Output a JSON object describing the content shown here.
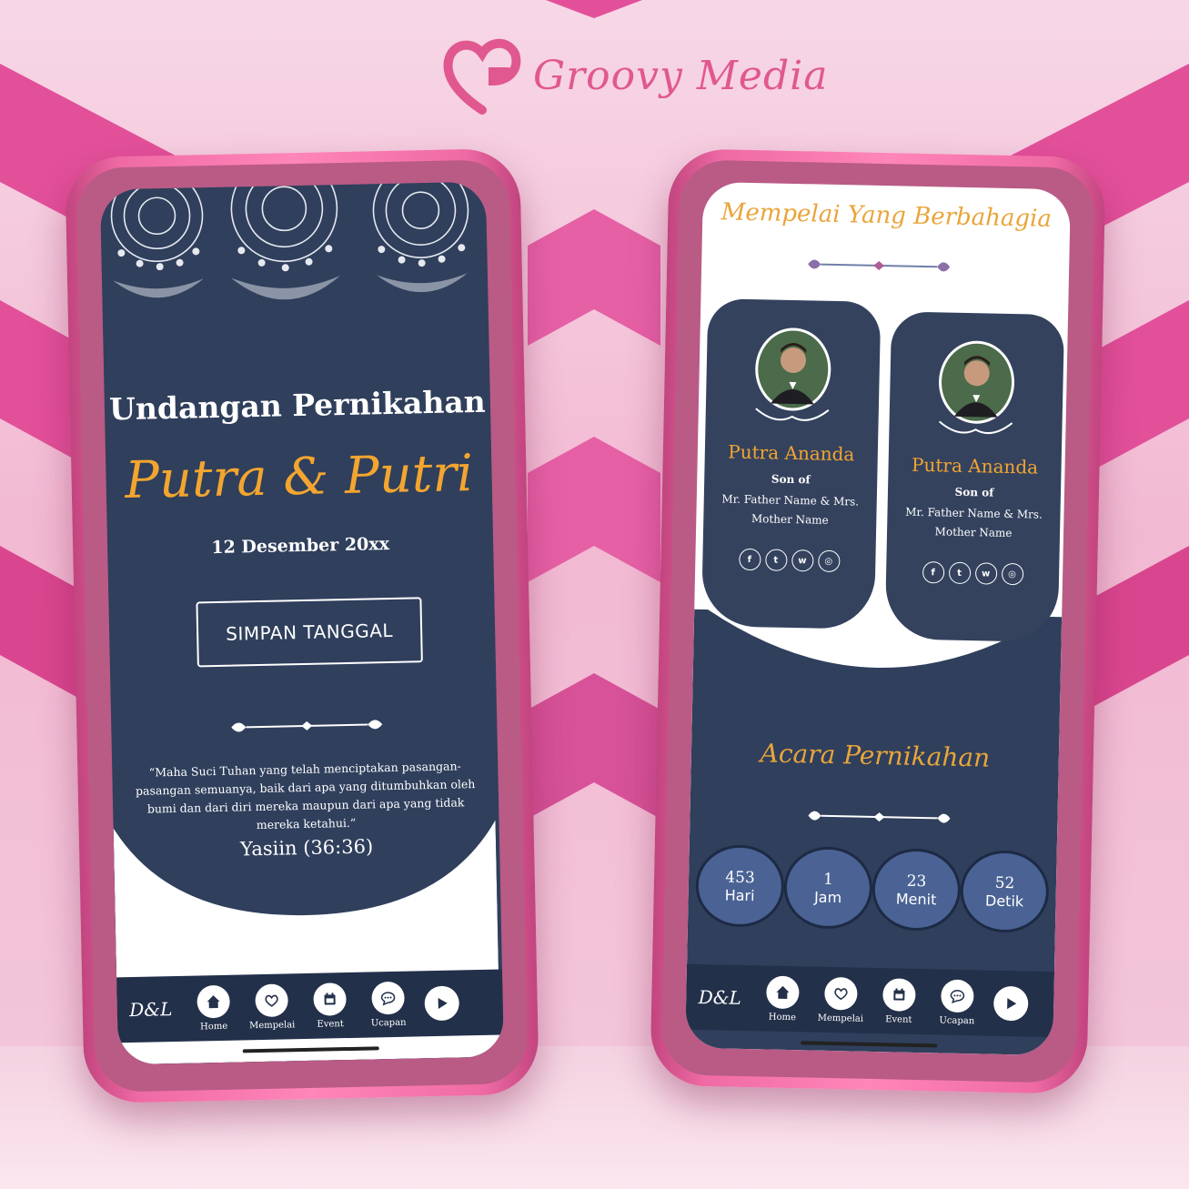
{
  "brand": {
    "name": "Groovy Media",
    "logo_icon": "heart-g-logo-icon",
    "color": "#e0588f"
  },
  "screen1": {
    "title": "Undangan Pernikahan",
    "couple": "Putra & Putri",
    "date": "12 Desember 20xx",
    "save_button": "SIMPAN TANGGAL",
    "quote": "“Maha Suci Tuhan yang telah menciptakan pasangan-pasangan semuanya, baik dari apa yang ditumbuhkan oleh bumi dan dari diri mereka maupun dari apa yang tidak mereka ketahui.”",
    "verse": "Yasiin (36:36)"
  },
  "screen2": {
    "title": "Mempelai Yang Berbahagia",
    "cards": [
      {
        "name": "Putra Ananda",
        "relation": "Son of",
        "parents": "Mr. Father Name & Mrs. Mother Name"
      },
      {
        "name": "Putra Ananda",
        "relation": "Son of",
        "parents": "Mr. Father Name & Mrs. Mother Name"
      }
    ],
    "event_title": "Acara Pernikahan",
    "countdown": [
      {
        "value": "453",
        "unit": "Hari"
      },
      {
        "value": "1",
        "unit": "Jam"
      },
      {
        "value": "23",
        "unit": "Menit"
      },
      {
        "value": "52",
        "unit": "Detik"
      }
    ]
  },
  "nav": {
    "logo": "D&L",
    "items": [
      {
        "label": "Home",
        "icon": "home-icon"
      },
      {
        "label": "Mempelai",
        "icon": "heart-icon"
      },
      {
        "label": "Event",
        "icon": "calendar-icon"
      },
      {
        "label": "Ucapan",
        "icon": "chat-icon"
      }
    ],
    "play_icon": "play-icon"
  },
  "colors": {
    "navy": "#2f3f5c",
    "gold": "#f3a530",
    "pink": "#ef6aa4"
  }
}
